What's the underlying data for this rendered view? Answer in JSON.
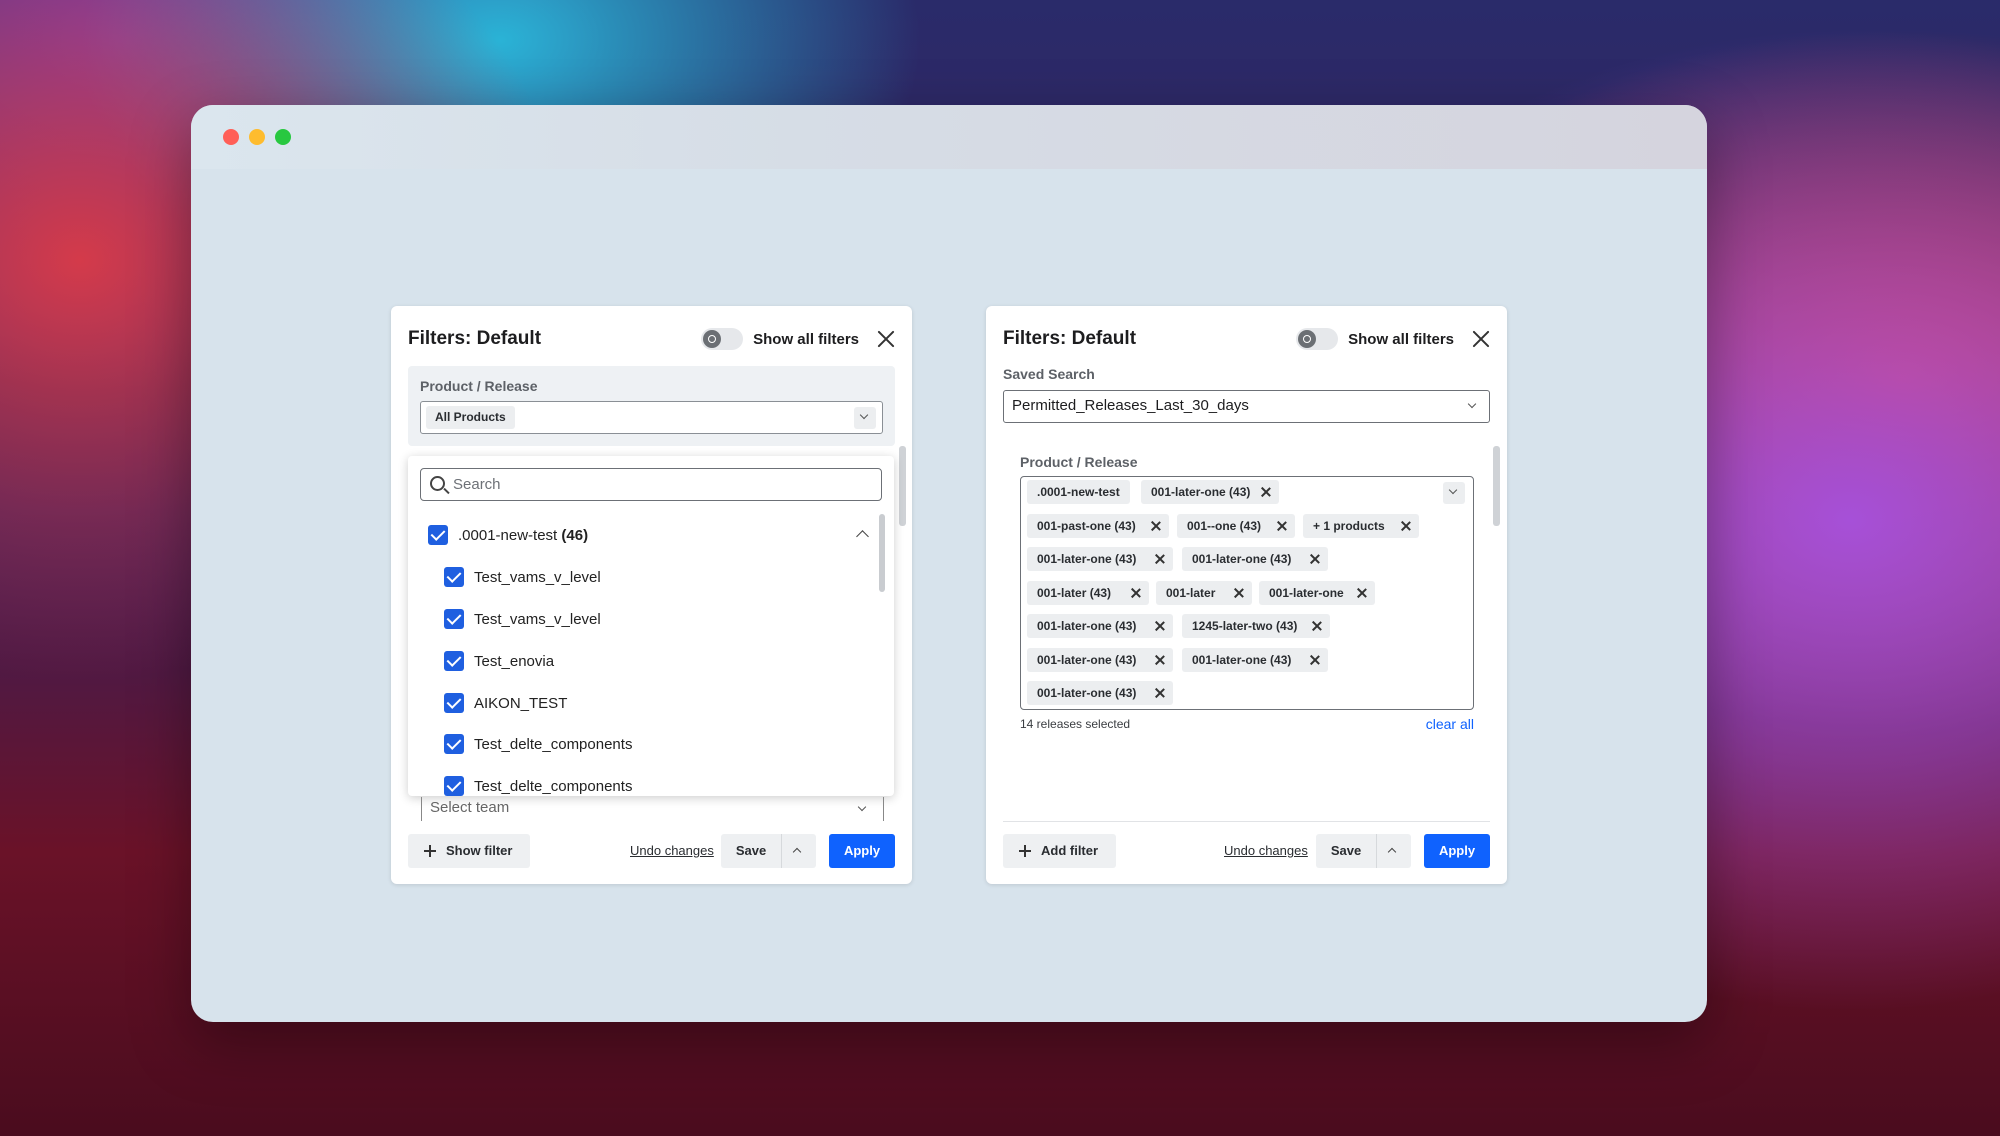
{
  "left_panel": {
    "title": "Filters: Default",
    "show_all_label": "Show all filters",
    "product_release_label": "Product / Release",
    "product_release_value": "All Products",
    "search_placeholder": "Search",
    "group": {
      "name": ".0001-new-test",
      "count": "(46)"
    },
    "items": [
      {
        "label": "Test_vams_v_level",
        "checked": true
      },
      {
        "label": "Test_vams_v_level",
        "checked": true
      },
      {
        "label": "Test_enovia",
        "checked": true
      },
      {
        "label": "AIKON_TEST",
        "checked": true
      },
      {
        "label": "Test_delte_components",
        "checked": true
      },
      {
        "label": "Test_delte_components",
        "checked": true
      }
    ],
    "select_team_placeholder": "Select team",
    "footer": {
      "show_filter": "Show filter",
      "undo": "Undo changes",
      "save": "Save",
      "apply": "Apply"
    }
  },
  "right_panel": {
    "title": "Filters: Default",
    "show_all_label": "Show all filters",
    "saved_search_label": "Saved Search",
    "saved_search_value": "Permitted_Releases_Last_30_days",
    "product_release_label": "Product / Release",
    "tags": [
      ".0001-new-test",
      "001-later-one (43)",
      "001-past-one (43)",
      "001--one (43)",
      "+ 1 products",
      "001-later-one (43)",
      "001-later-one (43)",
      "001-later (43)",
      "001-later",
      "001-later-one",
      "001-later-one (43)",
      "1245-later-two (43)",
      "001-later-one (43)",
      "001-later-one (43)",
      "001-later-one (43)"
    ],
    "count_text": "14 releases selected",
    "clear_all": "clear all",
    "footer": {
      "add_filter": "Add filter",
      "undo": "Undo changes",
      "save": "Save",
      "apply": "Apply"
    }
  },
  "colors": {
    "accent": "#0f62fe",
    "checkbox": "#1f5fe0"
  }
}
